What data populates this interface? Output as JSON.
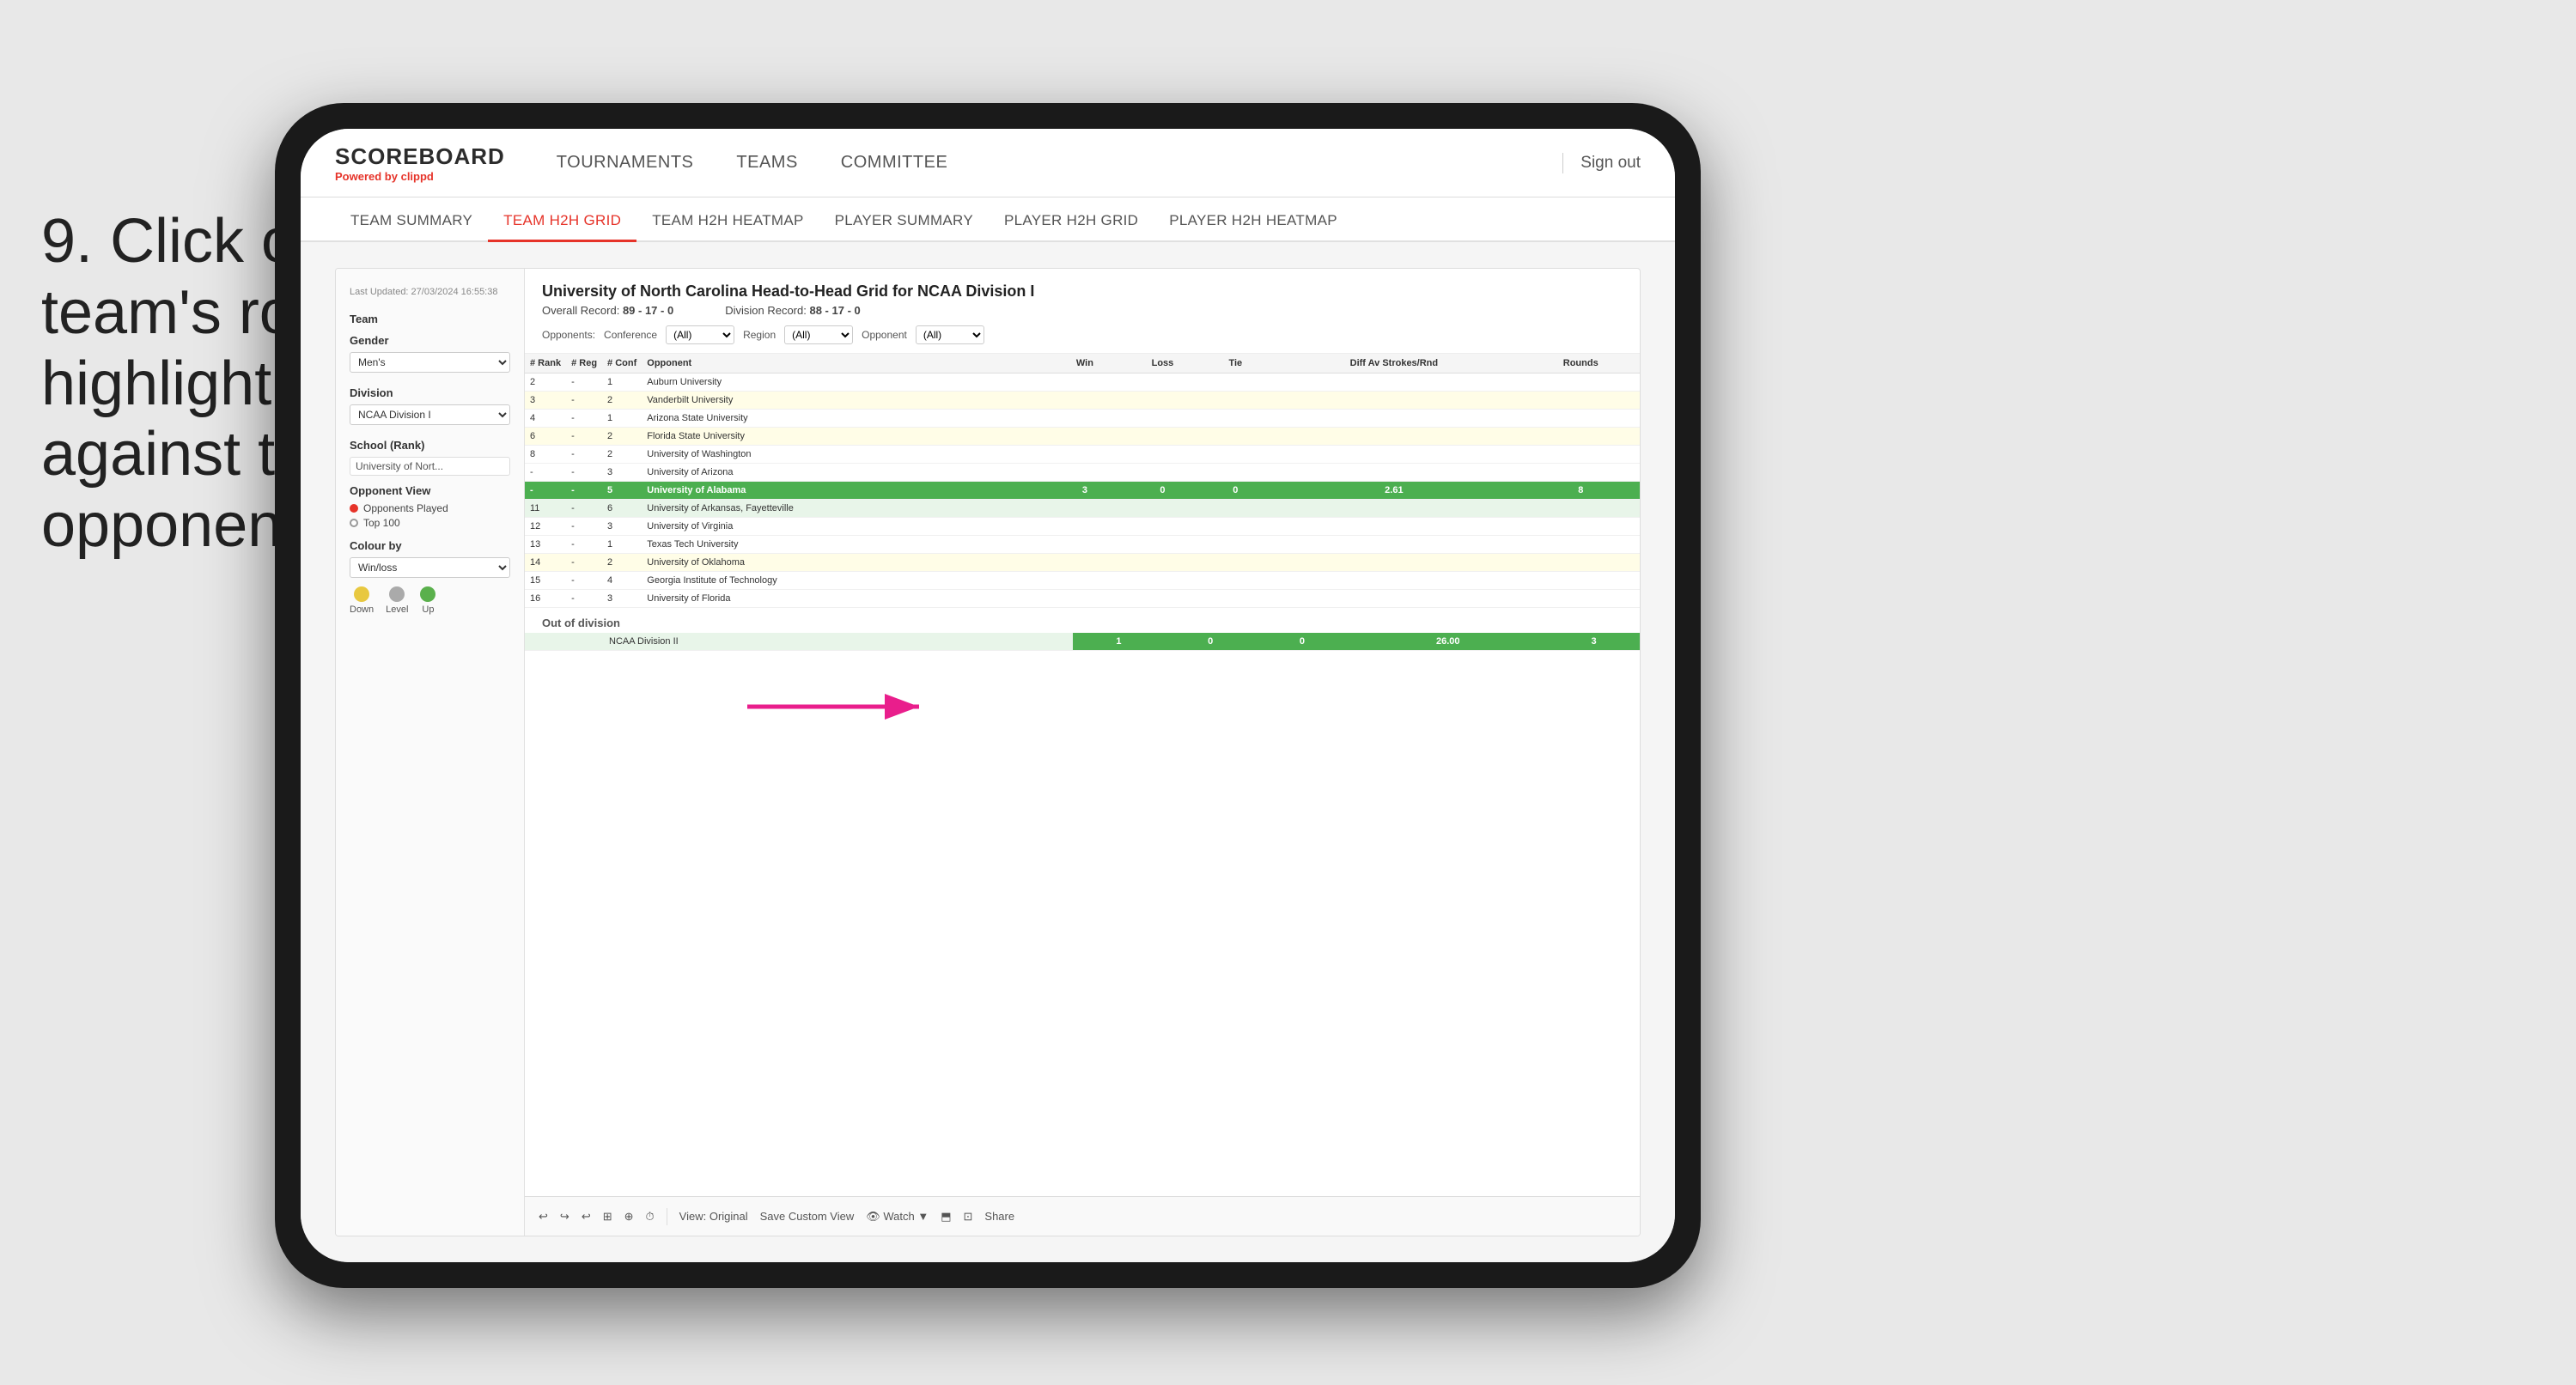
{
  "instruction": {
    "step": "9.",
    "text": "Click on a team's row to highlight results against that opponent"
  },
  "tablet": {
    "header": {
      "logo": "SCOREBOARD",
      "logo_sub": "Powered by",
      "logo_brand": "clippd",
      "nav": [
        {
          "label": "TOURNAMENTS",
          "id": "tournaments"
        },
        {
          "label": "TEAMS",
          "id": "teams"
        },
        {
          "label": "COMMITTEE",
          "id": "committee"
        }
      ],
      "sign_out": "Sign out"
    },
    "sub_nav": [
      {
        "label": "TEAM SUMMARY",
        "active": false
      },
      {
        "label": "TEAM H2H GRID",
        "active": true
      },
      {
        "label": "TEAM H2H HEATMAP",
        "active": false
      },
      {
        "label": "PLAYER SUMMARY",
        "active": false
      },
      {
        "label": "PLAYER H2H GRID",
        "active": false
      },
      {
        "label": "PLAYER H2H HEATMAP",
        "active": false
      }
    ],
    "sidebar": {
      "last_updated": "Last Updated: 27/03/2024 16:55:38",
      "team_label": "Team",
      "gender_label": "Gender",
      "gender_value": "Men's",
      "division_label": "Division",
      "division_value": "NCAA Division I",
      "school_rank_label": "School (Rank)",
      "school_rank_value": "University of Nort...",
      "opponent_view_label": "Opponent View",
      "opponent_view_options": [
        {
          "label": "Opponents Played",
          "selected": true
        },
        {
          "label": "Top 100",
          "selected": false
        }
      ],
      "colour_by_label": "Colour by",
      "colour_by_value": "Win/loss",
      "legend": [
        {
          "label": "Down",
          "color": "yellow"
        },
        {
          "label": "Level",
          "color": "gray"
        },
        {
          "label": "Up",
          "color": "green"
        }
      ]
    },
    "main": {
      "title": "University of North Carolina Head-to-Head Grid for NCAA Division I",
      "overall_record_label": "Overall Record:",
      "overall_record": "89 - 17 - 0",
      "division_record_label": "Division Record:",
      "division_record": "88 - 17 - 0",
      "filters": {
        "opponents_label": "Opponents:",
        "conference_label": "Conference",
        "conference_value": "(All)",
        "region_label": "Region",
        "region_value": "(All)",
        "opponent_label": "Opponent",
        "opponent_value": "(All)"
      },
      "table_headers": [
        {
          "label": "#\nRank",
          "id": "rank"
        },
        {
          "label": "#\nReg",
          "id": "reg"
        },
        {
          "label": "#\nConf",
          "id": "conf"
        },
        {
          "label": "Opponent",
          "id": "opponent"
        },
        {
          "label": "Win",
          "id": "win"
        },
        {
          "label": "Loss",
          "id": "loss"
        },
        {
          "label": "Tie",
          "id": "tie"
        },
        {
          "label": "Diff Av\nStrokes/Rnd",
          "id": "diff"
        },
        {
          "label": "Rounds",
          "id": "rounds"
        }
      ],
      "rows": [
        {
          "rank": "2",
          "reg": "-",
          "conf": "1",
          "opponent": "Auburn University",
          "win": "",
          "loss": "",
          "tie": "",
          "diff": "",
          "rounds": "",
          "style": "normal"
        },
        {
          "rank": "3",
          "reg": "-",
          "conf": "2",
          "opponent": "Vanderbilt University",
          "win": "",
          "loss": "",
          "tie": "",
          "diff": "",
          "rounds": "",
          "style": "light-yellow"
        },
        {
          "rank": "4",
          "reg": "-",
          "conf": "1",
          "opponent": "Arizona State University",
          "win": "",
          "loss": "",
          "tie": "",
          "diff": "",
          "rounds": "",
          "style": "normal"
        },
        {
          "rank": "6",
          "reg": "-",
          "conf": "2",
          "opponent": "Florida State University",
          "win": "",
          "loss": "",
          "tie": "",
          "diff": "",
          "rounds": "",
          "style": "light-yellow"
        },
        {
          "rank": "8",
          "reg": "-",
          "conf": "2",
          "opponent": "University of Washington",
          "win": "",
          "loss": "",
          "tie": "",
          "diff": "",
          "rounds": "",
          "style": "normal"
        },
        {
          "rank": "-",
          "reg": "-",
          "conf": "3",
          "opponent": "University of Arizona",
          "win": "",
          "loss": "",
          "tie": "",
          "diff": "",
          "rounds": "",
          "style": "normal"
        },
        {
          "rank": "-",
          "reg": "-",
          "conf": "5",
          "opponent": "University of Alabama",
          "win": "3",
          "loss": "0",
          "tie": "0",
          "diff": "2.61",
          "rounds": "8",
          "style": "highlighted"
        },
        {
          "rank": "11",
          "reg": "-",
          "conf": "6",
          "opponent": "University of Arkansas, Fayetteville",
          "win": "",
          "loss": "",
          "tie": "",
          "diff": "",
          "rounds": "",
          "style": "light-green"
        },
        {
          "rank": "12",
          "reg": "-",
          "conf": "3",
          "opponent": "University of Virginia",
          "win": "",
          "loss": "",
          "tie": "",
          "diff": "",
          "rounds": "",
          "style": "normal"
        },
        {
          "rank": "13",
          "reg": "-",
          "conf": "1",
          "opponent": "Texas Tech University",
          "win": "",
          "loss": "",
          "tie": "",
          "diff": "",
          "rounds": "",
          "style": "normal"
        },
        {
          "rank": "14",
          "reg": "-",
          "conf": "2",
          "opponent": "University of Oklahoma",
          "win": "",
          "loss": "",
          "tie": "",
          "diff": "",
          "rounds": "",
          "style": "light-yellow"
        },
        {
          "rank": "15",
          "reg": "-",
          "conf": "4",
          "opponent": "Georgia Institute of Technology",
          "win": "",
          "loss": "",
          "tie": "",
          "diff": "",
          "rounds": "",
          "style": "normal"
        },
        {
          "rank": "16",
          "reg": "-",
          "conf": "3",
          "opponent": "University of Florida",
          "win": "",
          "loss": "",
          "tie": "",
          "diff": "",
          "rounds": "",
          "style": "normal"
        }
      ],
      "out_of_division": {
        "label": "Out of division",
        "row": {
          "division": "NCAA Division II",
          "win": "1",
          "loss": "0",
          "tie": "0",
          "diff": "26.00",
          "rounds": "3"
        }
      },
      "toolbar": {
        "buttons": [
          "↩",
          "↪",
          "↩",
          "⊞",
          "⊕",
          "⏱",
          "View: Original",
          "Save Custom View",
          "👁 Watch ▼",
          "⬒",
          "⊡",
          "Share"
        ]
      }
    }
  }
}
